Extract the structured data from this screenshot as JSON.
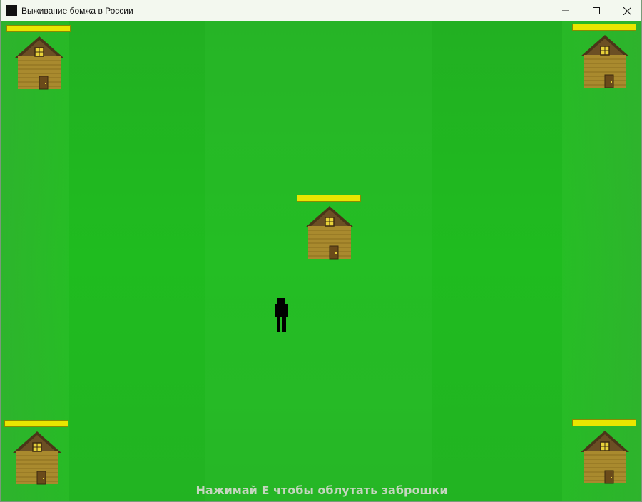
{
  "window": {
    "title": "Выживание бомжа в России",
    "app_icon": "app-icon",
    "controls": {
      "minimize_icon": "minimize-icon",
      "maximize_icon": "maximize-icon",
      "close_icon": "close-icon"
    }
  },
  "game": {
    "hint": "Нажимай E чтобы облутать заброшки",
    "background_color": "#1fbc1f",
    "houses": [
      {
        "name": "house-top-left",
        "health": 1.0
      },
      {
        "name": "house-top-right",
        "health": 1.0
      },
      {
        "name": "house-center",
        "health": 1.0
      },
      {
        "name": "house-bottom-left",
        "health": 1.0
      },
      {
        "name": "house-bottom-right",
        "health": 1.0
      }
    ],
    "health_bar_color": "#e9e600",
    "player_color": "#000000",
    "house_wall_color": "#a88a2a",
    "house_roof_color": "#4a3a1a"
  }
}
